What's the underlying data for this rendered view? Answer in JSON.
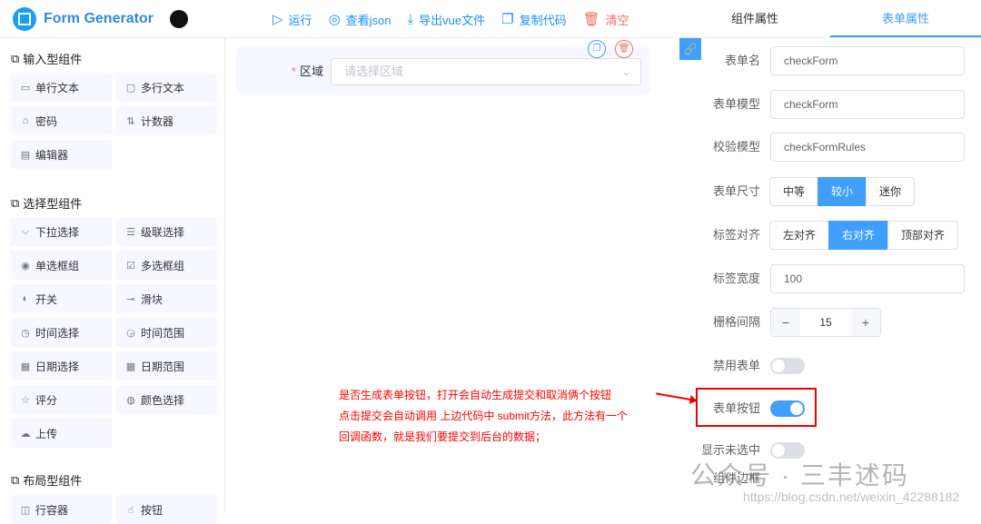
{
  "header": {
    "title": "Form Generator",
    "actions": [
      {
        "label": "运行",
        "icon": "play-icon"
      },
      {
        "label": "查看json",
        "icon": "eye-icon"
      },
      {
        "label": "导出vue文件",
        "icon": "download-icon"
      },
      {
        "label": "复制代码",
        "icon": "copy-icon"
      },
      {
        "label": "清空",
        "icon": "trash-icon"
      }
    ]
  },
  "left": {
    "sections": [
      {
        "title": "输入型组件",
        "items": [
          "单行文本",
          "多行文本",
          "密码",
          "计数器",
          "编辑器"
        ]
      },
      {
        "title": "选择型组件",
        "items": [
          "下拉选择",
          "级联选择",
          "单选框组",
          "多选框组",
          "开关",
          "滑块",
          "时间选择",
          "时间范围",
          "日期选择",
          "日期范围",
          "评分",
          "颜色选择",
          "上传"
        ]
      },
      {
        "title": "布局型组件",
        "items": [
          "行容器",
          "按钮"
        ]
      }
    ]
  },
  "center": {
    "field": {
      "label": "区域",
      "placeholder": "请选择区域"
    }
  },
  "annotation": [
    "是否生成表单按钮，打开会自动生成提交和取消俩个按钮",
    "点击提交会自动调用 上边代码中 submit方法，此方法有一个",
    "回调函数，就是我们要提交到后台的数据；"
  ],
  "right": {
    "tabs": [
      "组件属性",
      "表单属性"
    ],
    "form_name": {
      "label": "表单名",
      "value": "checkForm"
    },
    "form_model": {
      "label": "表单模型",
      "value": "checkForm"
    },
    "rules_model": {
      "label": "校验模型",
      "value": "checkFormRules"
    },
    "size": {
      "label": "表单尺寸",
      "options": [
        "中等",
        "较小",
        "迷你"
      ],
      "selected": "较小"
    },
    "label_align": {
      "label": "标签对齐",
      "options": [
        "左对齐",
        "右对齐",
        "顶部对齐"
      ],
      "selected": "右对齐"
    },
    "label_width": {
      "label": "标签宽度",
      "value": "100"
    },
    "gutter": {
      "label": "栅格间隔",
      "value": "15",
      "minus": "−",
      "plus": "+"
    },
    "disabled": {
      "label": "禁用表单",
      "on": false
    },
    "form_btns": {
      "label": "表单按钮",
      "on": true
    },
    "unfocused": {
      "label": "显示未选中",
      "on": false
    },
    "border": {
      "label": "组件边框"
    }
  },
  "watermark": {
    "text": "公众号 · 三丰述码",
    "url": "https://blog.csdn.net/weixin_42288182"
  }
}
